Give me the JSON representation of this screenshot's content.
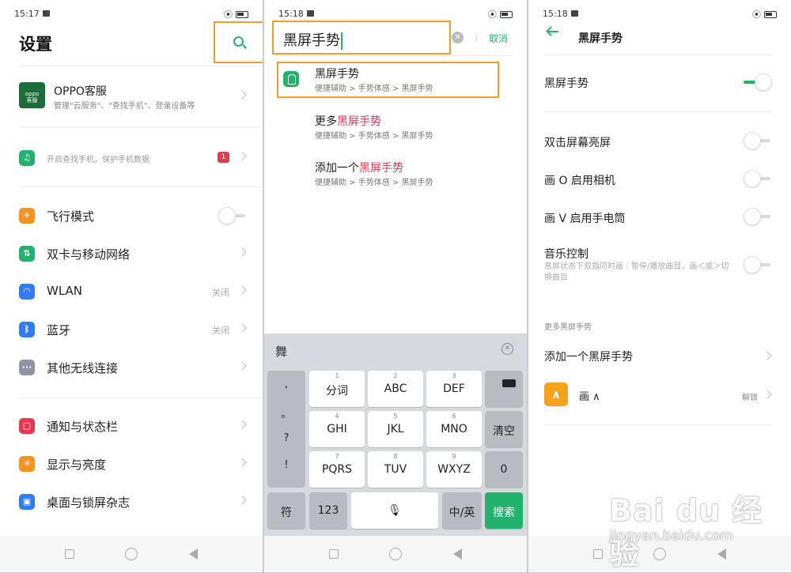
{
  "panel1": {
    "time": "15:17",
    "title": "设置",
    "oppo_logo": "oppo\n客服",
    "oppo_title": "OPPO客服",
    "oppo_desc": "管理\"云服务\"、\"查找手机\"、登录设备等",
    "find_phone": "开启查找手机，保护手机数据",
    "find_badge": "1",
    "items": [
      {
        "label": "飞行模式",
        "icon": "airplane-icon",
        "color": "#f7931e",
        "glyph": "✈"
      },
      {
        "label": "双卡与移动网络",
        "icon": "sim-icon",
        "color": "#21b36e",
        "glyph": "⇅"
      },
      {
        "label": "WLAN",
        "value": "关闭",
        "icon": "wifi-icon",
        "color": "#2f7cf6",
        "glyph": "◠"
      },
      {
        "label": "蓝牙",
        "value": "关闭",
        "icon": "bluetooth-icon",
        "color": "#2f7cf6",
        "glyph": "ᛒ"
      },
      {
        "label": "其他无线连接",
        "icon": "wireless-icon",
        "color": "#8e96a3",
        "glyph": "···"
      },
      {
        "label": "通知与状态栏",
        "icon": "notification-icon",
        "color": "#e8384f",
        "glyph": "▢"
      },
      {
        "label": "显示与亮度",
        "icon": "brightness-icon",
        "color": "#f7931e",
        "glyph": "☀"
      },
      {
        "label": "桌面与锁屏杂志",
        "icon": "wallpaper-icon",
        "color": "#2f7cf6",
        "glyph": "▣"
      }
    ]
  },
  "panel2": {
    "time": "15:18",
    "query": "黑屏手势",
    "cancel": "取消",
    "results": [
      {
        "prefix": "",
        "hl": "黑屏手势",
        "path": "便捷辅助 > 手势体感 > 黑屏手势"
      },
      {
        "prefix": "更多",
        "hl": "黑屏手势",
        "path": "便捷辅助 > 手势体感 > 黑屏手势"
      },
      {
        "prefix": "添加一个",
        "hl": "黑屏手势",
        "path": "便捷辅助 > 手势体感 > 黑屏手势"
      }
    ],
    "kb_candidate": "舞",
    "kb": {
      "punct": [
        ",",
        "。",
        "?",
        "!"
      ],
      "keys": [
        {
          "num": "1",
          "main": "分词"
        },
        {
          "num": "2",
          "main": "ABC"
        },
        {
          "num": "3",
          "main": "DEF"
        },
        {
          "num": "4",
          "main": "GHI"
        },
        {
          "num": "5",
          "main": "JKL"
        },
        {
          "num": "6",
          "main": "MNO"
        },
        {
          "num": "7",
          "main": "PQRS"
        },
        {
          "num": "8",
          "main": "TUV"
        },
        {
          "num": "9",
          "main": "WXYZ"
        }
      ],
      "clear": "清空",
      "zero": "0",
      "sym": "符",
      "num123": "123",
      "lang": "中/英",
      "search": "搜索"
    }
  },
  "panel3": {
    "time": "15:18",
    "title": "黑屏手势",
    "master": "黑屏手势",
    "options": [
      {
        "label": "双击屏幕亮屏"
      },
      {
        "label": "画 O 启用相机"
      },
      {
        "label": "画 V 启用手电筒"
      },
      {
        "label": "音乐控制"
      }
    ],
    "music_desc": "息屏状态下双指同时画｜暂停/播放曲目，画＜或＞切换曲目",
    "section": "更多黑屏手势",
    "add": "添加一个黑屏手势",
    "gesture_glyph": "∧",
    "gesture_label": "画 ∧",
    "unlock": "解锁"
  },
  "watermark": {
    "line1": "Bai du 经验",
    "line2": "jingyan.baidu.com"
  },
  "colors": {
    "accent": "#21b36e",
    "highlight": "#e8384f",
    "annotation": "#f39c2b"
  }
}
